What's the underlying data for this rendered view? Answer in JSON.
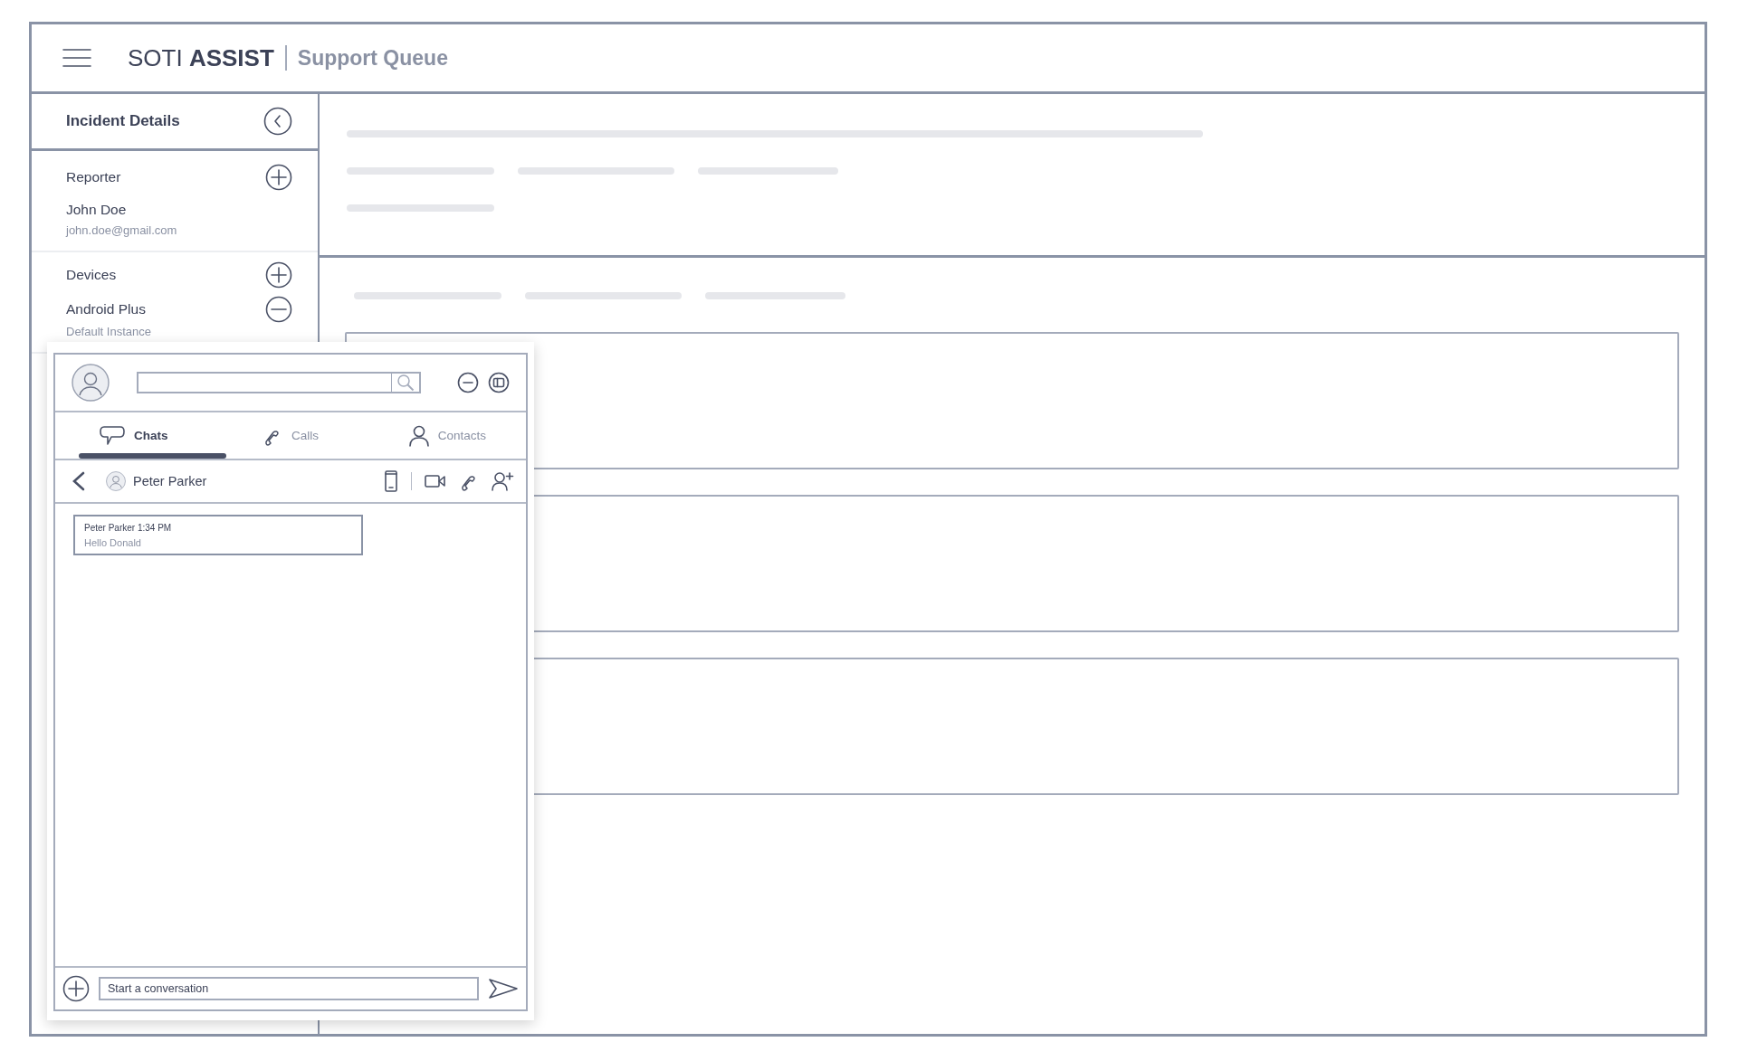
{
  "header": {
    "brand_regular": "SOTI",
    "brand_bold": "ASSIST",
    "page_title": "Support Queue"
  },
  "sidebar": {
    "title": "Incident Details",
    "reporter": {
      "heading": "Reporter",
      "name": "John Doe",
      "email": "john.doe@gmail.com"
    },
    "devices": {
      "heading": "Devices",
      "items": [
        {
          "name": "Android Plus",
          "detail": "Default Instance"
        }
      ]
    }
  },
  "chat": {
    "tabs": [
      {
        "label": "Chats",
        "kind": "chat",
        "selected": true
      },
      {
        "label": "Calls",
        "kind": "call",
        "selected": false
      },
      {
        "label": "Contacts",
        "kind": "contact",
        "selected": false
      }
    ],
    "conversation": {
      "contact": "Peter Parker"
    },
    "messages": [
      {
        "sender": "Peter Parker",
        "time": "1:34 PM",
        "text": "Hello Donald"
      }
    ],
    "composer": {
      "placeholder": "Start a conversation"
    }
  }
}
